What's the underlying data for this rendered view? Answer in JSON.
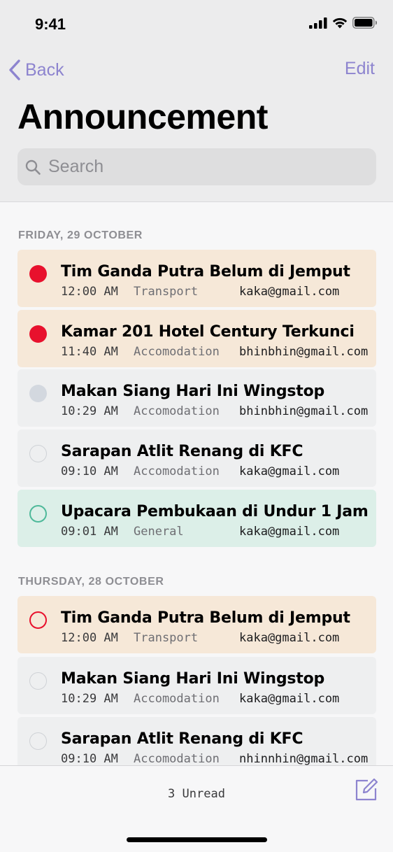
{
  "status": {
    "time": "9:41"
  },
  "nav": {
    "back_label": "Back",
    "edit_label": "Edit"
  },
  "title": "Announcement",
  "search": {
    "placeholder": "Search",
    "value": ""
  },
  "sections": [
    {
      "label": "FRIDAY, 29 OCTOBER",
      "items": [
        {
          "title": "Tim Ganda Putra Belum di Jemput",
          "time": "12:00 AM",
          "category": "Transport",
          "email": "kaka@gmail.com",
          "status": "unread-urgent"
        },
        {
          "title": "Kamar 201 Hotel Century Terkunci",
          "time": "11:40 AM",
          "category": "Accomodation",
          "email": "bhinbhin@gmail.com",
          "status": "unread-urgent"
        },
        {
          "title": "Makan Siang Hari Ini Wingstop",
          "time": "10:29 AM",
          "category": "Accomodation",
          "email": "bhinbhin@gmail.com",
          "status": "unread-normal"
        },
        {
          "title": "Sarapan Atlit Renang di KFC",
          "time": "09:10 AM",
          "category": "Accomodation",
          "email": "kaka@gmail.com",
          "status": "read"
        },
        {
          "title": "Upacara Pembukaan di Undur 1 Jam",
          "time": "09:01 AM",
          "category": "General",
          "email": "kaka@gmail.com",
          "status": "read-general"
        }
      ]
    },
    {
      "label": "THURSDAY, 28 OCTOBER",
      "items": [
        {
          "title": "Tim Ganda Putra Belum di Jemput",
          "time": "12:00 AM",
          "category": "Transport",
          "email": "kaka@gmail.com",
          "status": "read-urgent"
        },
        {
          "title": "Makan Siang Hari Ini Wingstop",
          "time": "10:29 AM",
          "category": "Accomodation",
          "email": "kaka@gmail.com",
          "status": "read"
        },
        {
          "title": "Sarapan Atlit Renang di KFC",
          "time": "09:10 AM",
          "category": "Accomodation",
          "email": "nhinnhin@gmail.com",
          "status": "read"
        }
      ]
    }
  ],
  "footer": {
    "unread_label": "3 Unread"
  },
  "colors": {
    "accent": "#8d84cf",
    "urgent_bg": "#f6e8d8",
    "normal_bg": "#eeeff0",
    "general_bg": "#dcefe8",
    "urgent_dot": "#e8112d",
    "unread_dot": "#d3d8df",
    "general_ring": "#4fb99a"
  },
  "icons": {
    "back": "chevron-left-icon",
    "search": "search-icon",
    "compose": "compose-icon"
  }
}
